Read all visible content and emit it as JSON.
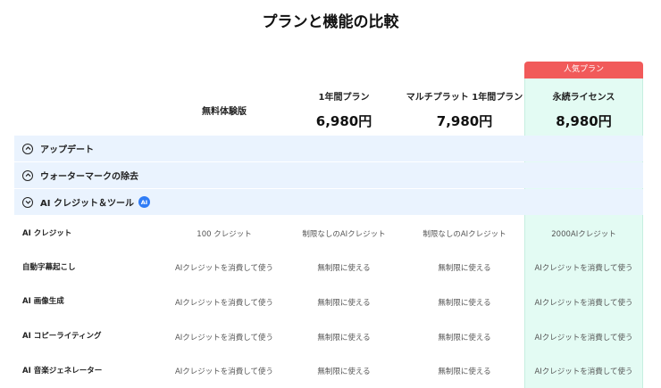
{
  "page_title": "プランと機能の比較",
  "popular_badge": "人気プラン",
  "plans": [
    {
      "name": "無料体験版",
      "price": ""
    },
    {
      "name": "1年間プラン",
      "price": "6,980円"
    },
    {
      "name": "マルチプラット 1年間プラン",
      "price": "7,980円"
    },
    {
      "name": "永続ライセンス",
      "price": "8,980円"
    }
  ],
  "sections": [
    {
      "label": "アップデート",
      "expanded": false
    },
    {
      "label": "ウォーターマークの除去",
      "expanded": false
    },
    {
      "label": "AI クレジット＆ツール",
      "expanded": true,
      "badge": "AI"
    }
  ],
  "features": [
    {
      "name": "AI クレジット",
      "values": [
        "100 クレジット",
        "制限なしのAIクレジット",
        "制限なしのAIクレジット",
        "2000AIクレジット"
      ]
    },
    {
      "name": "自動字幕起こし",
      "values": [
        "AIクレジットを消費して使う",
        "無制限に使える",
        "無制限に使える",
        "AIクレジットを消費して使う"
      ]
    },
    {
      "name": "AI 画像生成",
      "values": [
        "AIクレジットを消費して使う",
        "無制限に使える",
        "無制限に使える",
        "AIクレジットを消費して使う"
      ]
    },
    {
      "name": "AI コピーライティング",
      "values": [
        "AIクレジットを消費して使う",
        "無制限に使える",
        "無制限に使える",
        "AIクレジットを消費して使う"
      ]
    },
    {
      "name": "AI 音楽ジェネレーター",
      "values": [
        "AIクレジットを消費して使う",
        "無制限に使える",
        "無制限に使える",
        "AIクレジットを消費して使う"
      ]
    }
  ],
  "colors": {
    "accent_red": "#f15a5a",
    "highlight_green": "#e3fbf3",
    "section_blue": "#eaf3fe",
    "ai_badge_blue": "#2f7cf6"
  }
}
